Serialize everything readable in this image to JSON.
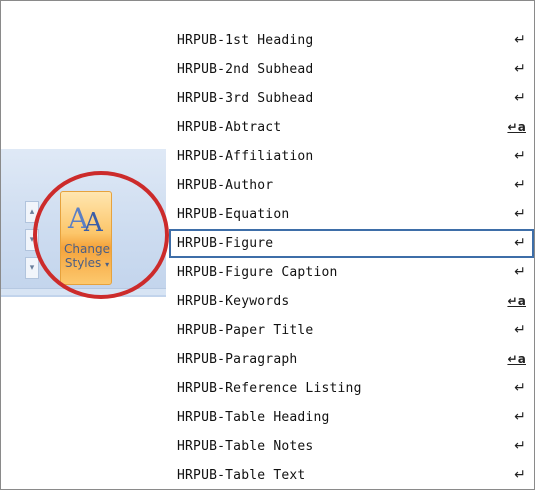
{
  "ribbon": {
    "change_styles_line1": "Change",
    "change_styles_line2": "Styles",
    "caret": "▾"
  },
  "styles": [
    {
      "name": "HRPUB-1st Heading",
      "mark": "↵",
      "selected": false
    },
    {
      "name": "HRPUB-2nd Subhead",
      "mark": "↵",
      "selected": false
    },
    {
      "name": "HRPUB-3rd Subhead",
      "mark": "↵",
      "selected": false
    },
    {
      "name": "HRPUB-Abtract",
      "mark": "↵a",
      "selected": false
    },
    {
      "name": "HRPUB-Affiliation",
      "mark": "↵",
      "selected": false
    },
    {
      "name": "HRPUB-Author",
      "mark": "↵",
      "selected": false
    },
    {
      "name": "HRPUB-Equation",
      "mark": "↵",
      "selected": false
    },
    {
      "name": "HRPUB-Figure",
      "mark": "↵",
      "selected": true
    },
    {
      "name": "HRPUB-Figure Caption",
      "mark": "↵",
      "selected": false
    },
    {
      "name": "HRPUB-Keywords",
      "mark": "↵a",
      "selected": false
    },
    {
      "name": "HRPUB-Paper Title",
      "mark": "↵",
      "selected": false
    },
    {
      "name": "HRPUB-Paragraph",
      "mark": "↵a",
      "selected": false
    },
    {
      "name": "HRPUB-Reference Listing",
      "mark": "↵",
      "selected": false
    },
    {
      "name": "HRPUB-Table Heading",
      "mark": "↵",
      "selected": false
    },
    {
      "name": "HRPUB-Table Notes",
      "mark": "↵",
      "selected": false
    },
    {
      "name": "HRPUB-Table Text",
      "mark": "↵",
      "selected": false
    }
  ],
  "colors": {
    "selection_border": "#3e6ea8",
    "highlight_circle": "#cc2b2b",
    "button_orange": "#fcc66a"
  },
  "icons": {
    "change_styles": "double-a-styles-icon",
    "paragraph_mark": "paragraph-style-icon",
    "linked_mark": "linked-style-icon"
  }
}
